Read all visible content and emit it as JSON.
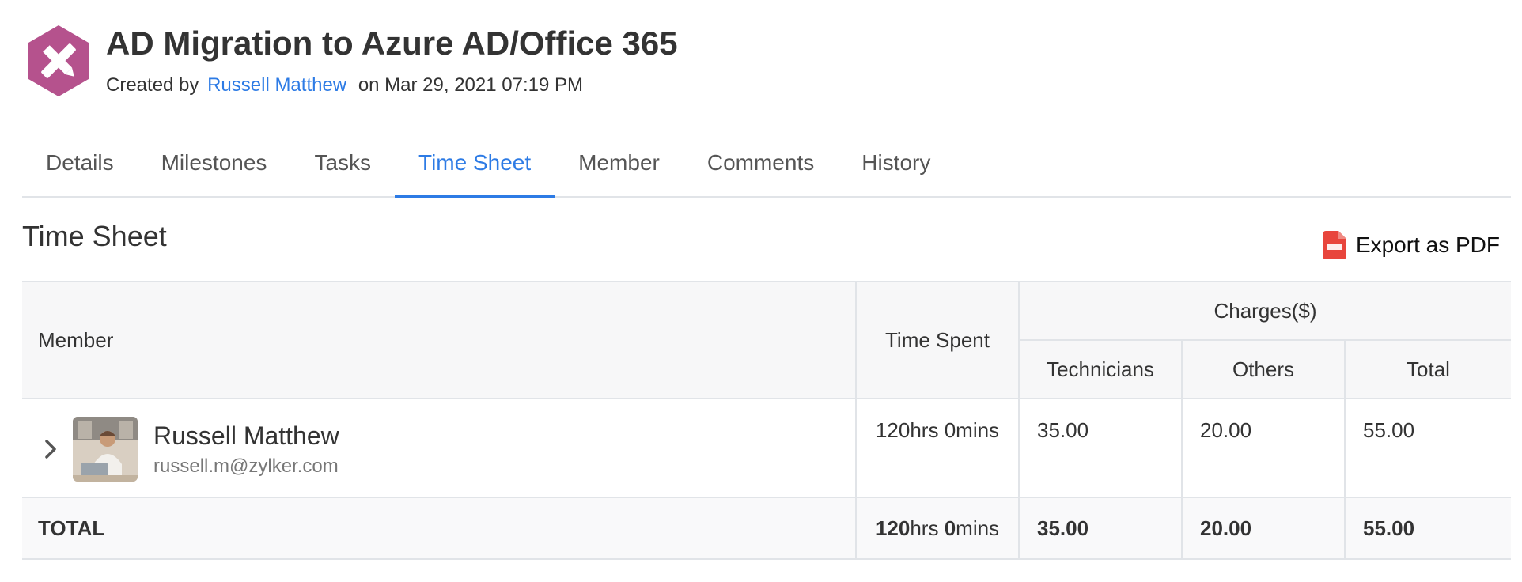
{
  "project": {
    "title": "AD Migration to Azure AD/Office 365",
    "created_by_prefix": "Created by",
    "author": "Russell Matthew",
    "created_on": "on Mar 29, 2021 07:19 PM",
    "icon": "pencil-ruler-icon",
    "icon_color": "#b5528d"
  },
  "tabs": [
    {
      "label": "Details"
    },
    {
      "label": "Milestones"
    },
    {
      "label": "Tasks"
    },
    {
      "label": "Time Sheet",
      "active": true
    },
    {
      "label": "Member"
    },
    {
      "label": "Comments"
    },
    {
      "label": "History"
    }
  ],
  "section": {
    "title": "Time Sheet",
    "export_label": "Export as PDF",
    "export_icon": "pdf-icon"
  },
  "table": {
    "headers": {
      "member": "Member",
      "time_spent": "Time Spent",
      "charges": "Charges($)",
      "technicians": "Technicians",
      "others": "Others",
      "total": "Total"
    },
    "rows": [
      {
        "name": "Russell Matthew",
        "email": "russell.m@zylker.com",
        "hours": "120",
        "hrs_unit": "hrs",
        "mins": "0",
        "mins_unit": "mins",
        "technicians": "35.00",
        "others": "20.00",
        "total": "55.00"
      }
    ],
    "totals": {
      "label": "TOTAL",
      "hours": "120",
      "hrs_unit": "hrs",
      "mins": "0",
      "mins_unit": "mins",
      "technicians": "35.00",
      "others": "20.00",
      "total": "55.00"
    }
  },
  "colors": {
    "accent": "#2d7be5",
    "pdf_red": "#e8453c"
  }
}
